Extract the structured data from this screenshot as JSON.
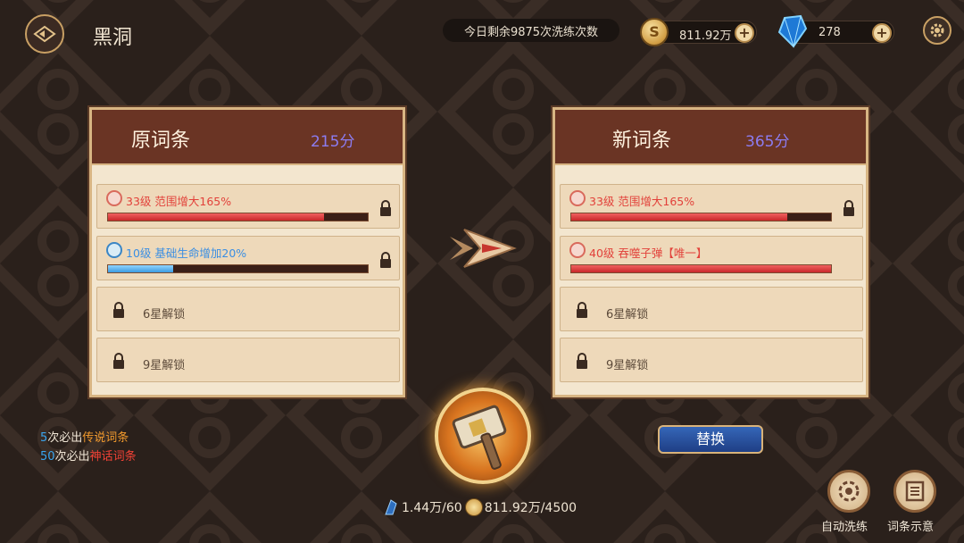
{
  "header": {
    "title": "黑洞",
    "remain_text": "今日剩余9875次洗练次数",
    "coins": "811.92万",
    "gems": "278"
  },
  "old_panel": {
    "title": "原词条",
    "score": "215分",
    "attrs": [
      {
        "text": "33级 范围增大165%",
        "color": "red",
        "progress": 0.83
      },
      {
        "text": "10级 基础生命增加20%",
        "color": "blue",
        "progress": 0.25
      }
    ],
    "locked": [
      "6星解锁",
      "9星解锁"
    ]
  },
  "new_panel": {
    "title": "新词条",
    "score": "365分",
    "attrs": [
      {
        "text": "33级 范围增大165%",
        "color": "red",
        "progress": 0.83
      },
      {
        "text": "40级 吞噬子弹【唯一】",
        "color": "red",
        "progress": 1.0
      }
    ],
    "locked": [
      "6星解锁",
      "9星解锁"
    ]
  },
  "tips": {
    "line1_num": "5",
    "line1_mid": "次必出",
    "line1_tag": "传说词条",
    "line2_num": "50",
    "line2_mid": "次必出",
    "line2_tag": "神话词条"
  },
  "cost": {
    "crystal": "1.44万/60",
    "coin": "811.92万/4500"
  },
  "buttons": {
    "replace": "替换",
    "auto_refine": "自动洗练",
    "attr_preview": "词条示意"
  },
  "colors": {
    "red_text": "#e2413a",
    "blue_text": "#3a8ee3",
    "score": "#8c7cf0",
    "panel_header": "#6a3424"
  }
}
